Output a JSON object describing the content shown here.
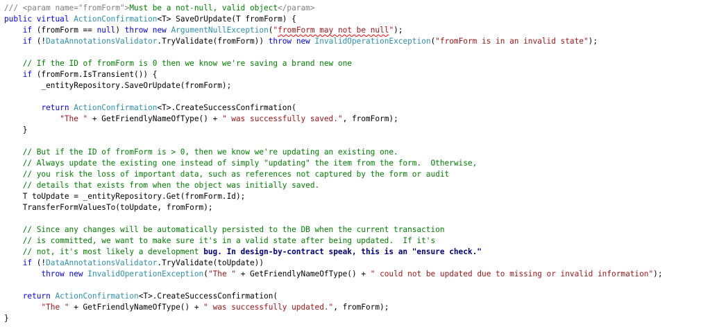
{
  "lines": [
    {
      "indent": 0,
      "tokens": [
        {
          "t": "/// ",
          "c": "xg"
        },
        {
          "t": "<param name=\"fromForm\">",
          "c": "xg"
        },
        {
          "t": "Must be a not-null, valid object",
          "c": "cm"
        },
        {
          "t": "</param>",
          "c": "xg"
        }
      ]
    },
    {
      "indent": 0,
      "tokens": [
        {
          "t": "public",
          "c": "kw"
        },
        {
          "t": " ",
          "c": "pn"
        },
        {
          "t": "virtual",
          "c": "kw"
        },
        {
          "t": " ",
          "c": "pn"
        },
        {
          "t": "ActionConfirmation",
          "c": "ty"
        },
        {
          "t": "<T> SaveOrUpdate(T fromForm) {",
          "c": "pn"
        }
      ]
    },
    {
      "indent": 4,
      "tokens": [
        {
          "t": "if",
          "c": "kw"
        },
        {
          "t": " (fromForm == ",
          "c": "pn"
        },
        {
          "t": "null",
          "c": "kw"
        },
        {
          "t": ") ",
          "c": "pn"
        },
        {
          "t": "throw",
          "c": "kw"
        },
        {
          "t": " ",
          "c": "pn"
        },
        {
          "t": "new",
          "c": "kw"
        },
        {
          "t": " ",
          "c": "pn"
        },
        {
          "t": "ArgumentNullException",
          "c": "ty"
        },
        {
          "t": "(",
          "c": "pn"
        },
        {
          "t": "\"",
          "c": "st"
        },
        {
          "t": "fromForm may not be null",
          "c": "st",
          "sq": true
        },
        {
          "t": "\"",
          "c": "st"
        },
        {
          "t": ");",
          "c": "pn"
        }
      ]
    },
    {
      "indent": 4,
      "tokens": [
        {
          "t": "if",
          "c": "kw"
        },
        {
          "t": " (!",
          "c": "pn"
        },
        {
          "t": "DataAnnotationsValidator",
          "c": "ty"
        },
        {
          "t": ".TryValidate(fromForm)) ",
          "c": "pn"
        },
        {
          "t": "throw",
          "c": "kw"
        },
        {
          "t": " ",
          "c": "pn"
        },
        {
          "t": "new",
          "c": "kw"
        },
        {
          "t": " ",
          "c": "pn"
        },
        {
          "t": "InvalidOperationException",
          "c": "ty"
        },
        {
          "t": "(",
          "c": "pn"
        },
        {
          "t": "\"fromForm is in an invalid state\"",
          "c": "st"
        },
        {
          "t": ");",
          "c": "pn"
        }
      ]
    },
    {
      "indent": 0,
      "tokens": []
    },
    {
      "indent": 4,
      "tokens": [
        {
          "t": "// If the ID of fromForm is 0 then we know we're saving a brand new one",
          "c": "cm"
        }
      ]
    },
    {
      "indent": 4,
      "tokens": [
        {
          "t": "if",
          "c": "kw"
        },
        {
          "t": " (fromForm.IsTransient()) {",
          "c": "pn"
        }
      ]
    },
    {
      "indent": 8,
      "tokens": [
        {
          "t": "_entityRepository.SaveOrUpdate(fromForm);",
          "c": "pn"
        }
      ]
    },
    {
      "indent": 0,
      "tokens": []
    },
    {
      "indent": 8,
      "tokens": [
        {
          "t": "return",
          "c": "kw"
        },
        {
          "t": " ",
          "c": "pn"
        },
        {
          "t": "ActionConfirmation",
          "c": "ty"
        },
        {
          "t": "<T>.CreateSuccessConfirmation(",
          "c": "pn"
        }
      ]
    },
    {
      "indent": 12,
      "tokens": [
        {
          "t": "\"The \"",
          "c": "st"
        },
        {
          "t": " + GetFriendlyNameOfType() + ",
          "c": "pn"
        },
        {
          "t": "\" was successfully saved.\"",
          "c": "st"
        },
        {
          "t": ", fromForm);",
          "c": "pn"
        }
      ]
    },
    {
      "indent": 4,
      "tokens": [
        {
          "t": "}",
          "c": "pn"
        }
      ]
    },
    {
      "indent": 0,
      "tokens": []
    },
    {
      "indent": 4,
      "tokens": [
        {
          "t": "// But if the ID of fromForm is > 0, then we know we're updating an existing one.",
          "c": "cm"
        }
      ]
    },
    {
      "indent": 4,
      "tokens": [
        {
          "t": "// Always update the existing one instead of simply \"updating\" the item from the form.  Otherwise,",
          "c": "cm"
        }
      ]
    },
    {
      "indent": 4,
      "tokens": [
        {
          "t": "// you risk the loss of important data, such as references not captured by the form or audit",
          "c": "cm"
        }
      ]
    },
    {
      "indent": 4,
      "tokens": [
        {
          "t": "// details that exists from when the object was initially saved.",
          "c": "cm"
        }
      ]
    },
    {
      "indent": 4,
      "tokens": [
        {
          "t": "T toUpdate = _entityRepository.Get(fromForm.Id);",
          "c": "pn"
        }
      ]
    },
    {
      "indent": 4,
      "tokens": [
        {
          "t": "TransferFormValuesTo(toUpdate, fromForm);",
          "c": "pn"
        }
      ]
    },
    {
      "indent": 0,
      "tokens": []
    },
    {
      "indent": 4,
      "tokens": [
        {
          "t": "// Since any changes will be automatically persisted to the DB when the current transaction",
          "c": "cm"
        }
      ]
    },
    {
      "indent": 4,
      "tokens": [
        {
          "t": "// is committed, we want to make sure it's in a valid state after being updated.  If it's",
          "c": "cm"
        }
      ]
    },
    {
      "indent": 4,
      "tokens": [
        {
          "t": "// not, it's most likely a development ",
          "c": "cm"
        },
        {
          "t": "bug. In design-by-contract speak, this is an \"ensure check.\"",
          "c": "cmb"
        }
      ]
    },
    {
      "indent": 4,
      "tokens": [
        {
          "t": "if",
          "c": "kw"
        },
        {
          "t": " (!",
          "c": "pn"
        },
        {
          "t": "DataAnnotationsValidator",
          "c": "ty"
        },
        {
          "t": ".TryValidate(toUpdate))",
          "c": "pn"
        }
      ]
    },
    {
      "indent": 8,
      "tokens": [
        {
          "t": "throw",
          "c": "kw"
        },
        {
          "t": " ",
          "c": "pn"
        },
        {
          "t": "new",
          "c": "kw"
        },
        {
          "t": " ",
          "c": "pn"
        },
        {
          "t": "InvalidOperationException",
          "c": "ty"
        },
        {
          "t": "(",
          "c": "pn"
        },
        {
          "t": "\"The \"",
          "c": "st"
        },
        {
          "t": " + GetFriendlyNameOfType() + ",
          "c": "pn"
        },
        {
          "t": "\" could not be updated due to missing or invalid information\"",
          "c": "st"
        },
        {
          "t": ");",
          "c": "pn"
        }
      ]
    },
    {
      "indent": 0,
      "tokens": []
    },
    {
      "indent": 4,
      "tokens": [
        {
          "t": "return",
          "c": "kw"
        },
        {
          "t": " ",
          "c": "pn"
        },
        {
          "t": "ActionConfirmation",
          "c": "ty"
        },
        {
          "t": "<T>.CreateSuccessConfirmation(",
          "c": "pn"
        }
      ]
    },
    {
      "indent": 8,
      "tokens": [
        {
          "t": "\"The \"",
          "c": "st"
        },
        {
          "t": " + GetFriendlyNameOfType() + ",
          "c": "pn"
        },
        {
          "t": "\" was successfully updated.\"",
          "c": "st"
        },
        {
          "t": ", fromForm);",
          "c": "pn"
        }
      ]
    },
    {
      "indent": 0,
      "tokens": [
        {
          "t": "}",
          "c": "pn"
        }
      ]
    }
  ]
}
